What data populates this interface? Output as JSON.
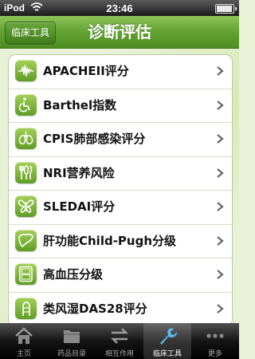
{
  "status_bar": {
    "carrier": "iPod",
    "time": "23:46"
  },
  "nav": {
    "back_label": "临床工具",
    "title": "诊断评估"
  },
  "list_items": [
    {
      "label": "APACHEII评分",
      "icon": "waveform-icon"
    },
    {
      "label": "Barthel指数",
      "icon": "wheelchair-icon"
    },
    {
      "label": "CPIS肺部感染评分",
      "icon": "lungs-icon"
    },
    {
      "label": "NRI营养风险",
      "icon": "utensils-icon"
    },
    {
      "label": "SLEDAI评分",
      "icon": "butterfly-icon"
    },
    {
      "label": "肝功能Child-Pugh分级",
      "icon": "liver-icon"
    },
    {
      "label": "高血压分级",
      "icon": "blood-pressure-monitor-icon"
    },
    {
      "label": "类风湿DAS28评分",
      "icon": "finger-joint-icon"
    }
  ],
  "tabs": [
    {
      "label": "主页",
      "icon": "home-icon",
      "active": false
    },
    {
      "label": "药品目录",
      "icon": "folder-icon",
      "active": false
    },
    {
      "label": "相互作用",
      "icon": "swap-arrows-icon",
      "active": false
    },
    {
      "label": "临床工具",
      "icon": "wrench-icon",
      "active": true
    },
    {
      "label": "更多",
      "icon": "more-dots-icon",
      "active": false
    }
  ],
  "colors": {
    "nav_green": "#64a233",
    "icon_green": "#7db83c",
    "background": "#e9f2d6"
  }
}
